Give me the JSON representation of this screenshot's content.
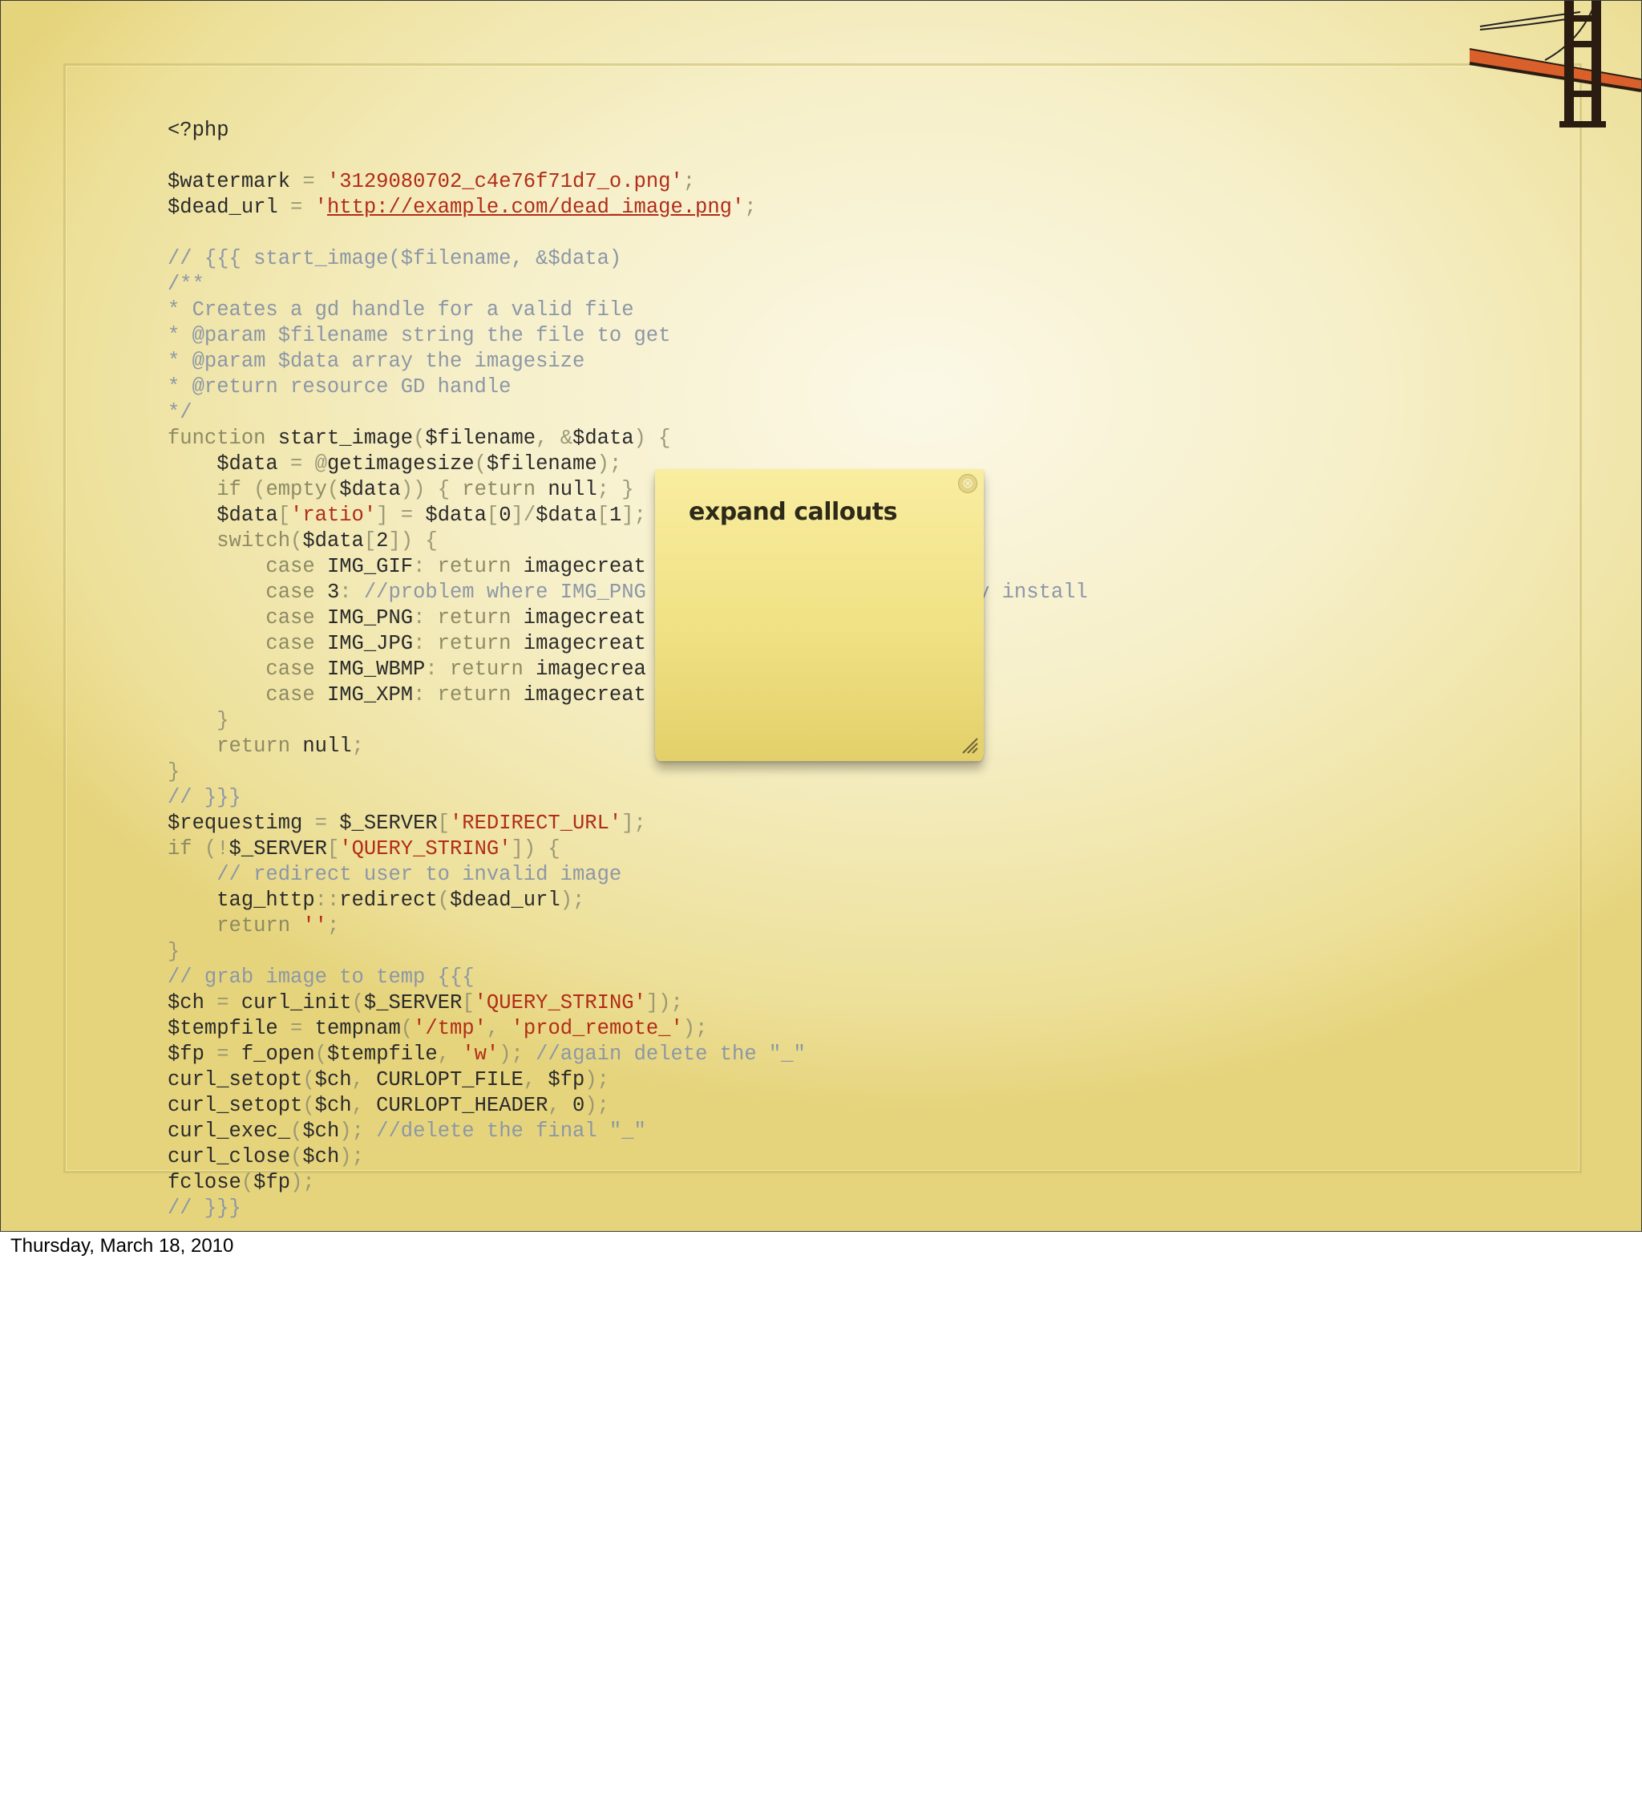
{
  "slide": {
    "code_lines": [
      [
        {
          "t": "<?php",
          "c": "d"
        }
      ],
      [],
      [
        {
          "t": "$watermark",
          "c": "d"
        },
        {
          "t": " = ",
          "c": "p"
        },
        {
          "t": "'3129080702_c4e76f71d7_o.png'",
          "c": "s"
        },
        {
          "t": ";",
          "c": "p"
        }
      ],
      [
        {
          "t": "$dead_url",
          "c": "d"
        },
        {
          "t": " = ",
          "c": "p"
        },
        {
          "t": "'",
          "c": "s"
        },
        {
          "t": "http://example.com/dead_image.png",
          "c": "u"
        },
        {
          "t": "'",
          "c": "s"
        },
        {
          "t": ";",
          "c": "p"
        }
      ],
      [],
      [
        {
          "t": "// {{{ start_image($filename, &$data)",
          "c": "c"
        }
      ],
      [
        {
          "t": "/**",
          "c": "c"
        }
      ],
      [
        {
          "t": "* Creates a gd handle for a valid file",
          "c": "c"
        }
      ],
      [
        {
          "t": "* @param $filename string the file to get",
          "c": "c"
        }
      ],
      [
        {
          "t": "* @param $data array the imagesize",
          "c": "c"
        }
      ],
      [
        {
          "t": "* @return resource GD handle",
          "c": "c"
        }
      ],
      [
        {
          "t": "*/",
          "c": "c"
        }
      ],
      [
        {
          "t": "function ",
          "c": "k"
        },
        {
          "t": "start_image",
          "c": "d"
        },
        {
          "t": "(",
          "c": "p"
        },
        {
          "t": "$filename",
          "c": "d"
        },
        {
          "t": ", &",
          "c": "p"
        },
        {
          "t": "$data",
          "c": "d"
        },
        {
          "t": ") {",
          "c": "p"
        }
      ],
      [
        {
          "t": "    $data",
          "c": "d"
        },
        {
          "t": " = @",
          "c": "p"
        },
        {
          "t": "getimagesize",
          "c": "d"
        },
        {
          "t": "(",
          "c": "p"
        },
        {
          "t": "$filename",
          "c": "d"
        },
        {
          "t": ");",
          "c": "p"
        }
      ],
      [
        {
          "t": "    if ",
          "c": "k"
        },
        {
          "t": "(",
          "c": "p"
        },
        {
          "t": "empty",
          "c": "k"
        },
        {
          "t": "(",
          "c": "p"
        },
        {
          "t": "$data",
          "c": "d"
        },
        {
          "t": ")) { ",
          "c": "p"
        },
        {
          "t": "return ",
          "c": "k"
        },
        {
          "t": "null",
          "c": "d"
        },
        {
          "t": "; }",
          "c": "p"
        }
      ],
      [
        {
          "t": "    $data",
          "c": "d"
        },
        {
          "t": "[",
          "c": "p"
        },
        {
          "t": "'ratio'",
          "c": "s"
        },
        {
          "t": "] = ",
          "c": "p"
        },
        {
          "t": "$data",
          "c": "d"
        },
        {
          "t": "[",
          "c": "p"
        },
        {
          "t": "0",
          "c": "d"
        },
        {
          "t": "]/",
          "c": "p"
        },
        {
          "t": "$data",
          "c": "d"
        },
        {
          "t": "[",
          "c": "p"
        },
        {
          "t": "1",
          "c": "d"
        },
        {
          "t": "];",
          "c": "p"
        }
      ],
      [
        {
          "t": "    switch",
          "c": "k"
        },
        {
          "t": "(",
          "c": "p"
        },
        {
          "t": "$data",
          "c": "d"
        },
        {
          "t": "[",
          "c": "p"
        },
        {
          "t": "2",
          "c": "d"
        },
        {
          "t": "]) {",
          "c": "p"
        }
      ],
      [
        {
          "t": "        case ",
          "c": "k"
        },
        {
          "t": "IMG_GIF",
          "c": "d"
        },
        {
          "t": ": ",
          "c": "p"
        },
        {
          "t": "return ",
          "c": "k"
        },
        {
          "t": "imagecreat",
          "c": "d"
        }
      ],
      [
        {
          "t": "        case ",
          "c": "k"
        },
        {
          "t": "3",
          "c": "d"
        },
        {
          "t": ": ",
          "c": "p"
        },
        {
          "t": "//problem where IMG_PNG",
          "c": "c"
        },
        {
          "t": "                        ",
          "c": "p"
        },
        {
          "t": "r my install",
          "c": "c"
        }
      ],
      [
        {
          "t": "        case ",
          "c": "k"
        },
        {
          "t": "IMG_PNG",
          "c": "d"
        },
        {
          "t": ": ",
          "c": "p"
        },
        {
          "t": "return ",
          "c": "k"
        },
        {
          "t": "imagecreat",
          "c": "d"
        }
      ],
      [
        {
          "t": "        case ",
          "c": "k"
        },
        {
          "t": "IMG_JPG",
          "c": "d"
        },
        {
          "t": ": ",
          "c": "p"
        },
        {
          "t": "return ",
          "c": "k"
        },
        {
          "t": "imagecreat",
          "c": "d"
        }
      ],
      [
        {
          "t": "        case ",
          "c": "k"
        },
        {
          "t": "IMG_WBMP",
          "c": "d"
        },
        {
          "t": ": ",
          "c": "p"
        },
        {
          "t": "return ",
          "c": "k"
        },
        {
          "t": "imagecrea",
          "c": "d"
        }
      ],
      [
        {
          "t": "        case ",
          "c": "k"
        },
        {
          "t": "IMG_XPM",
          "c": "d"
        },
        {
          "t": ": ",
          "c": "p"
        },
        {
          "t": "return ",
          "c": "k"
        },
        {
          "t": "imagecreat",
          "c": "d"
        }
      ],
      [
        {
          "t": "    }",
          "c": "p"
        }
      ],
      [
        {
          "t": "    return ",
          "c": "k"
        },
        {
          "t": "null",
          "c": "d"
        },
        {
          "t": ";",
          "c": "p"
        }
      ],
      [
        {
          "t": "}",
          "c": "p"
        }
      ],
      [
        {
          "t": "// }}}",
          "c": "c"
        }
      ],
      [
        {
          "t": "$requestimg",
          "c": "d"
        },
        {
          "t": " = ",
          "c": "p"
        },
        {
          "t": "$_SERVER",
          "c": "d"
        },
        {
          "t": "[",
          "c": "p"
        },
        {
          "t": "'REDIRECT_URL'",
          "c": "s"
        },
        {
          "t": "];",
          "c": "p"
        }
      ],
      [
        {
          "t": "if ",
          "c": "k"
        },
        {
          "t": "(!",
          "c": "p"
        },
        {
          "t": "$_SERVER",
          "c": "d"
        },
        {
          "t": "[",
          "c": "p"
        },
        {
          "t": "'QUERY_STRING'",
          "c": "s"
        },
        {
          "t": "]) {",
          "c": "p"
        }
      ],
      [
        {
          "t": "    // redirect user to invalid image",
          "c": "c"
        }
      ],
      [
        {
          "t": "    tag_http",
          "c": "d"
        },
        {
          "t": "::",
          "c": "p"
        },
        {
          "t": "redirect",
          "c": "d"
        },
        {
          "t": "(",
          "c": "p"
        },
        {
          "t": "$dead_url",
          "c": "d"
        },
        {
          "t": ");",
          "c": "p"
        }
      ],
      [
        {
          "t": "    return ",
          "c": "k"
        },
        {
          "t": "''",
          "c": "s"
        },
        {
          "t": ";",
          "c": "p"
        }
      ],
      [
        {
          "t": "}",
          "c": "p"
        }
      ],
      [
        {
          "t": "// grab image to temp {{{",
          "c": "c"
        }
      ],
      [
        {
          "t": "$ch",
          "c": "d"
        },
        {
          "t": " = ",
          "c": "p"
        },
        {
          "t": "curl_init",
          "c": "d"
        },
        {
          "t": "(",
          "c": "p"
        },
        {
          "t": "$_SERVER",
          "c": "d"
        },
        {
          "t": "[",
          "c": "p"
        },
        {
          "t": "'QUERY_STRING'",
          "c": "s"
        },
        {
          "t": "]);",
          "c": "p"
        }
      ],
      [
        {
          "t": "$tempfile",
          "c": "d"
        },
        {
          "t": " = ",
          "c": "p"
        },
        {
          "t": "tempnam",
          "c": "d"
        },
        {
          "t": "(",
          "c": "p"
        },
        {
          "t": "'/tmp'",
          "c": "s"
        },
        {
          "t": ", ",
          "c": "p"
        },
        {
          "t": "'prod_remote_'",
          "c": "s"
        },
        {
          "t": ");",
          "c": "p"
        }
      ],
      [
        {
          "t": "$fp",
          "c": "d"
        },
        {
          "t": " = ",
          "c": "p"
        },
        {
          "t": "f_open",
          "c": "d"
        },
        {
          "t": "(",
          "c": "p"
        },
        {
          "t": "$tempfile",
          "c": "d"
        },
        {
          "t": ", ",
          "c": "p"
        },
        {
          "t": "'w'",
          "c": "s"
        },
        {
          "t": "); ",
          "c": "p"
        },
        {
          "t": "//again delete the \"_\"",
          "c": "c"
        }
      ],
      [
        {
          "t": "curl_setopt",
          "c": "d"
        },
        {
          "t": "(",
          "c": "p"
        },
        {
          "t": "$ch",
          "c": "d"
        },
        {
          "t": ", ",
          "c": "p"
        },
        {
          "t": "CURLOPT_FILE",
          "c": "d"
        },
        {
          "t": ", ",
          "c": "p"
        },
        {
          "t": "$fp",
          "c": "d"
        },
        {
          "t": ");",
          "c": "p"
        }
      ],
      [
        {
          "t": "curl_setopt",
          "c": "d"
        },
        {
          "t": "(",
          "c": "p"
        },
        {
          "t": "$ch",
          "c": "d"
        },
        {
          "t": ", ",
          "c": "p"
        },
        {
          "t": "CURLOPT_HEADER",
          "c": "d"
        },
        {
          "t": ", ",
          "c": "p"
        },
        {
          "t": "0",
          "c": "d"
        },
        {
          "t": ");",
          "c": "p"
        }
      ],
      [
        {
          "t": "curl_exec_",
          "c": "d"
        },
        {
          "t": "(",
          "c": "p"
        },
        {
          "t": "$ch",
          "c": "d"
        },
        {
          "t": "); ",
          "c": "p"
        },
        {
          "t": "//delete the final \"_\"",
          "c": "c"
        }
      ],
      [
        {
          "t": "curl_close",
          "c": "d"
        },
        {
          "t": "(",
          "c": "p"
        },
        {
          "t": "$ch",
          "c": "d"
        },
        {
          "t": ");",
          "c": "p"
        }
      ],
      [
        {
          "t": "fclose",
          "c": "d"
        },
        {
          "t": "(",
          "c": "p"
        },
        {
          "t": "$fp",
          "c": "d"
        },
        {
          "t": ");",
          "c": "p"
        }
      ],
      [
        {
          "t": "// }}}",
          "c": "c"
        }
      ]
    ]
  },
  "note": {
    "title": "expand callouts",
    "close_glyph": "⊗"
  },
  "footer": {
    "date": "Thursday, March 18, 2010"
  },
  "colors": {
    "keyword": "#8d8a64",
    "comment": "#8c97a6",
    "string": "#b22c18",
    "default": "#2a2a2a",
    "note_yellow": "#f0e184",
    "bridge_orange": "#d9602a"
  },
  "icons": {
    "bridge": "golden-gate-bridge-icon",
    "close": "close-icon",
    "resize": "resize-grip-icon"
  }
}
